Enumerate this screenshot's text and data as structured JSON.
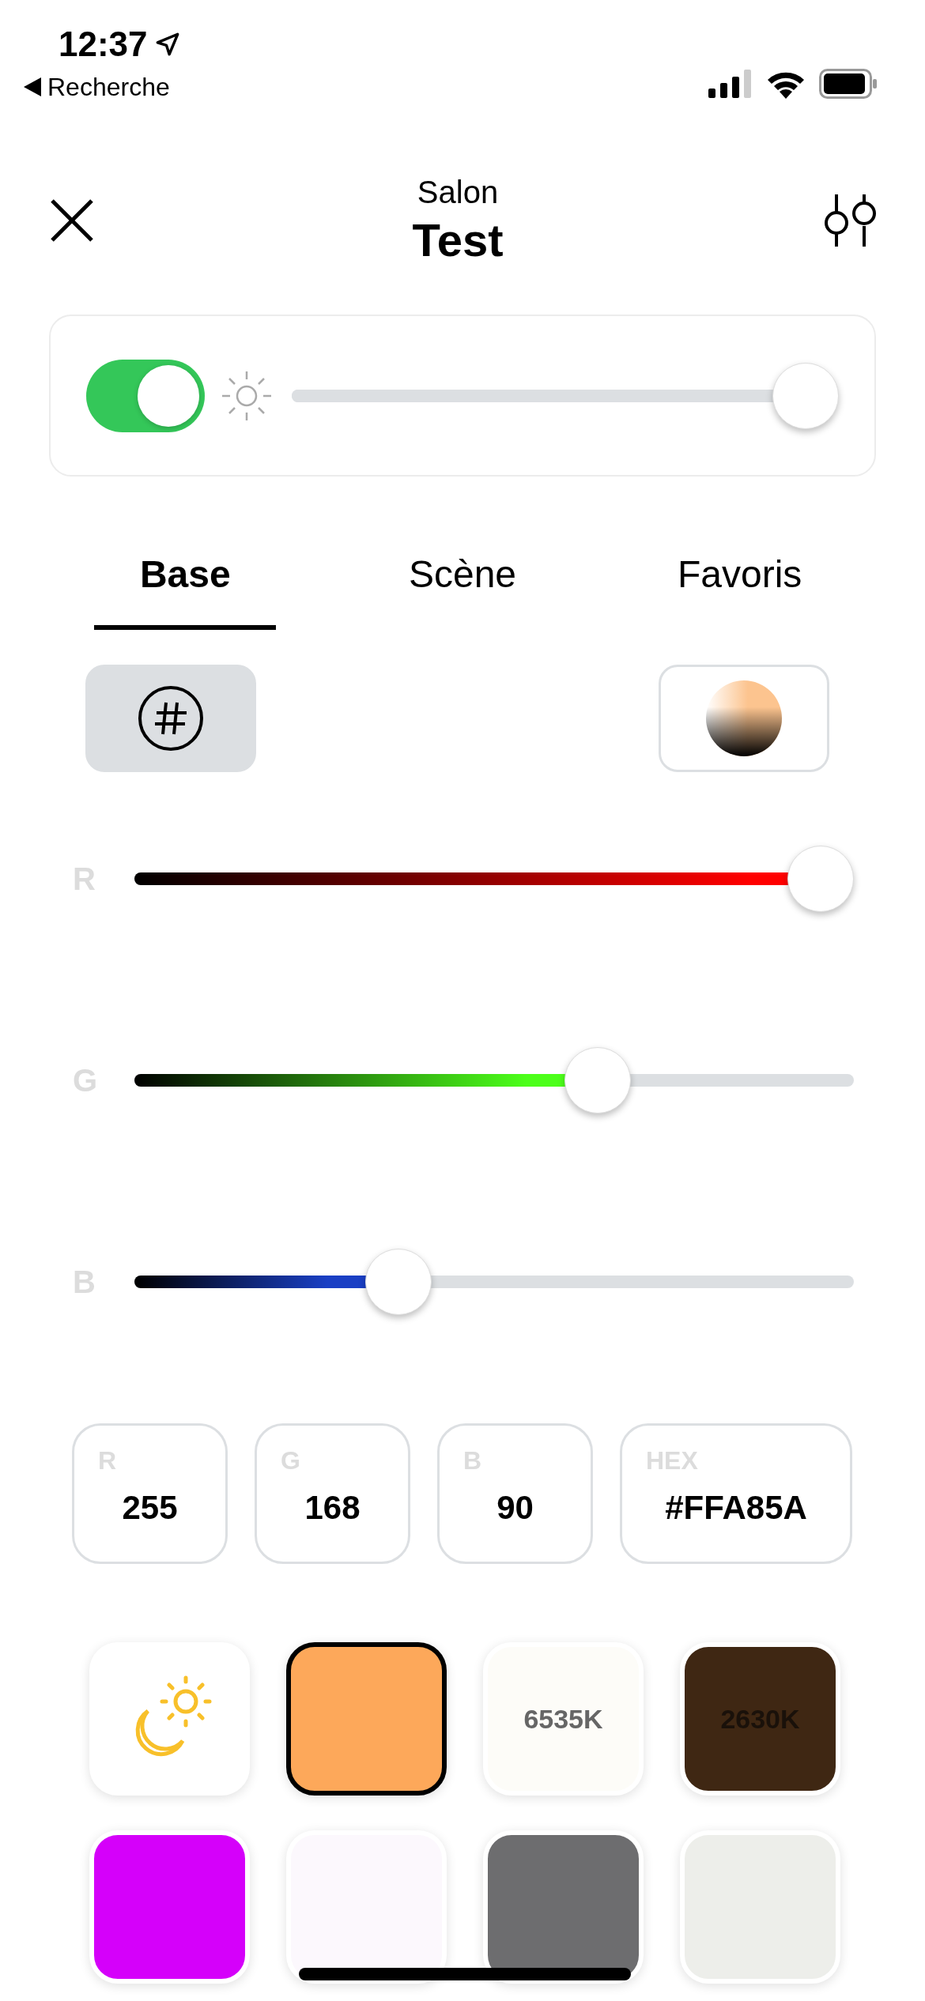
{
  "status_bar": {
    "time": "12:37",
    "back_label": "Recherche"
  },
  "header": {
    "subtitle": "Salon",
    "title": "Test"
  },
  "power": {
    "on": true,
    "level": 1
  },
  "tabs": [
    {
      "label": "Base",
      "selected": true
    },
    {
      "label": "Scène",
      "selected": false
    },
    {
      "label": "Favoris",
      "selected": false
    }
  ],
  "modes": [
    {
      "kind": "hex",
      "selected": true
    },
    {
      "kind": "wheel",
      "selected": false
    }
  ],
  "channels": [
    {
      "label": "R",
      "level": 1,
      "color": "#ff0000"
    },
    {
      "label": "G",
      "level": 0.659,
      "color": "#4cff1a"
    },
    {
      "label": "B",
      "level": 0.353,
      "color": "#1a3fc4"
    }
  ],
  "values": [
    {
      "label": "R",
      "value": "255"
    },
    {
      "label": "G",
      "value": "168"
    },
    {
      "label": "B",
      "value": "90"
    },
    {
      "label": "HEX",
      "value": "#FFA85A"
    }
  ],
  "swatches": [
    {
      "kind": "auto",
      "selected": false
    },
    {
      "kind": "color",
      "color": "#fda85a",
      "selected": true
    },
    {
      "kind": "temperature",
      "color": "#fdfcf8",
      "label": "6535K",
      "selected": false
    },
    {
      "kind": "temperature",
      "color": "#3f2713",
      "label": "2630K",
      "selected": false
    },
    {
      "kind": "color",
      "color": "#d500fa",
      "selected": false
    },
    {
      "kind": "color",
      "color": "#fcf8fd",
      "selected": false
    },
    {
      "kind": "color",
      "color": "#6d6d6f",
      "selected": false
    },
    {
      "kind": "color",
      "color": "#edeeea",
      "selected": false
    }
  ]
}
